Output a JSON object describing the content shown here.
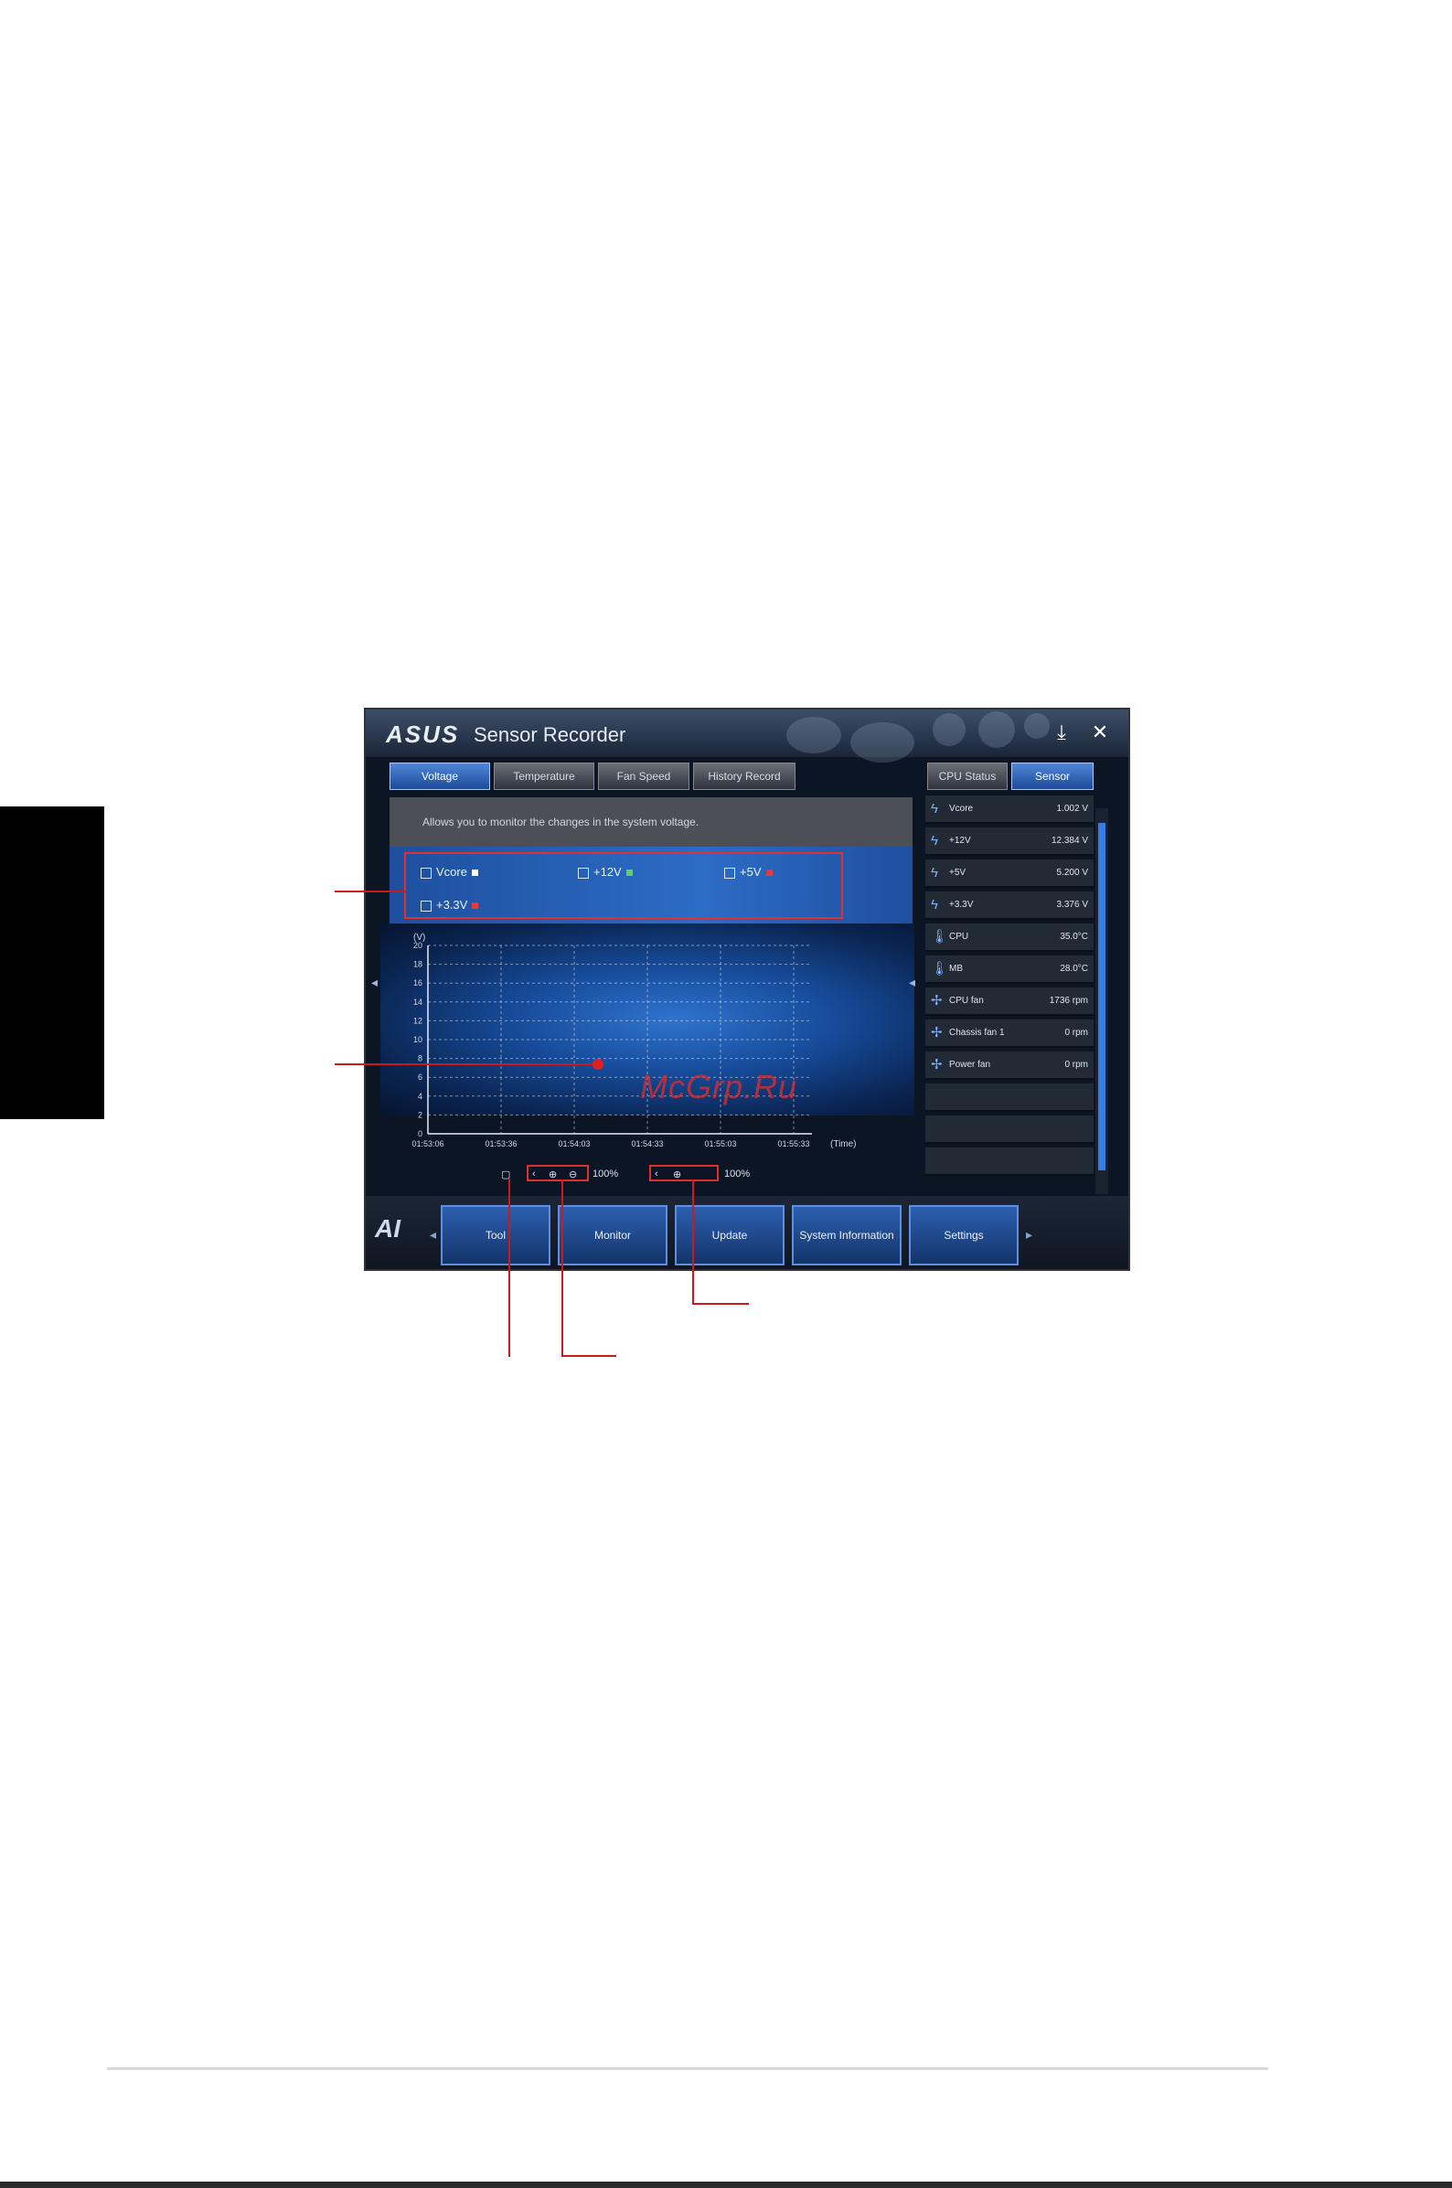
{
  "app": {
    "logo": "ASUS",
    "title": "Sensor Recorder",
    "minimize_glyph": "⤓",
    "close_glyph": "✕"
  },
  "tabs": [
    {
      "label": "Voltage",
      "active": true
    },
    {
      "label": "Temperature",
      "active": false
    },
    {
      "label": "Fan Speed",
      "active": false
    },
    {
      "label": "History Record",
      "active": false
    }
  ],
  "description": "Allows you to monitor the changes in the system voltage.",
  "checkboxes": [
    {
      "label": "Vcore",
      "color": "#ffffff"
    },
    {
      "label": "+12V",
      "color": "#5dd35d"
    },
    {
      "label": "+5V",
      "color": "#e33a3a"
    },
    {
      "label": "+3.3V",
      "color": "#e33a3a"
    }
  ],
  "chart_data": {
    "type": "line",
    "ylabel": "(V)",
    "xlabel": "(Time)",
    "ylim": [
      0,
      20
    ],
    "yticks": [
      0,
      2,
      4,
      6,
      8,
      10,
      12,
      14,
      16,
      18,
      20
    ],
    "x": [
      "01:53:06",
      "01:53:36",
      "01:54:03",
      "01:54:33",
      "01:55:03",
      "01:55:33"
    ],
    "grid": true,
    "series": []
  },
  "zoom": {
    "left_pct": "100%",
    "right_pct": "100%"
  },
  "right_tabs": [
    {
      "label": "CPU Status",
      "active": false
    },
    {
      "label": "Sensor",
      "active": true
    }
  ],
  "sensors": [
    {
      "icon": "lightning-icon",
      "label": "Vcore",
      "value": "1.002 V"
    },
    {
      "icon": "lightning-icon",
      "label": "+12V",
      "value": "12.384 V"
    },
    {
      "icon": "lightning-icon",
      "label": "+5V",
      "value": "5.200 V"
    },
    {
      "icon": "lightning-icon",
      "label": "+3.3V",
      "value": "3.376 V"
    },
    {
      "icon": "thermometer-icon",
      "label": "CPU",
      "value": "35.0°C"
    },
    {
      "icon": "thermometer-icon",
      "label": "MB",
      "value": "28.0°C"
    },
    {
      "icon": "fan-icon",
      "label": "CPU fan",
      "value": "1736 rpm"
    },
    {
      "icon": "fan-icon",
      "label": "Chassis fan 1",
      "value": "0 rpm"
    },
    {
      "icon": "fan-icon",
      "label": "Power fan",
      "value": "0 rpm"
    }
  ],
  "nav_buttons": [
    {
      "label": "Tool"
    },
    {
      "label": "Monitor"
    },
    {
      "label": "Update"
    },
    {
      "label": "System Information"
    },
    {
      "label": "Settings"
    }
  ],
  "watermark": "McGrp.Ru",
  "colors": {
    "accent": "#2c6cc6",
    "callout": "#cc1a1a"
  }
}
